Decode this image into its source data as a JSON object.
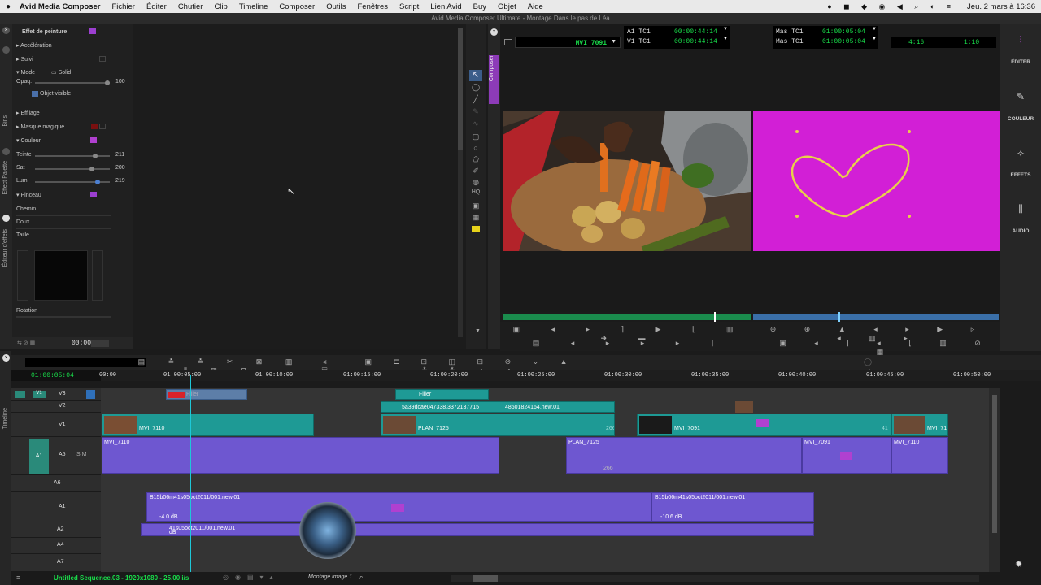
{
  "menubar": {
    "apple": "",
    "app": "Avid Media Composer",
    "items": [
      "Fichier",
      "Éditer",
      "Chutier",
      "Clip",
      "Timeline",
      "Composer",
      "Outils",
      "Fenêtres",
      "Script",
      "Lien Avid",
      "Buy",
      "Objet",
      "Aide"
    ],
    "datetime": "Jeu. 2 mars à 16:36"
  },
  "window_title": "Avid Media Composer Ultimate - Montage Dans le pas de Léa",
  "sidetabs": {
    "bins": "Bins",
    "effect_palette": "Effect Palette",
    "effect_editor": "Éditeur d'effets",
    "composer": "Composer",
    "timeline": "Timeline"
  },
  "effect_editor": {
    "title": "Effet de peinture",
    "acceleration": "Accélération",
    "suivi": "Suivi",
    "mode": "Mode",
    "mode_value": "Solid",
    "opacity": "Opaq.",
    "opacity_value": "100",
    "opacity_level": 1.0,
    "objet_visible": "Objet visible",
    "effilage": "Effilage",
    "masque": "Masque magique",
    "couleur": "Couleur",
    "teinte": "Teinte",
    "teinte_value": "211",
    "teinte_level": 0.83,
    "sat": "Sat",
    "sat_value": "200",
    "sat_level": 0.78,
    "lum": "Lum",
    "lum_value": "219",
    "lum_level": 0.86,
    "pinceau": "Pinceau",
    "chemin": "Chemin",
    "doux": "Doux",
    "taille": "Taille",
    "rotation": "Rotation",
    "time": "00:00"
  },
  "composer": {
    "src_clip": "MVI_7091",
    "a1_tc1": "A1  TC1",
    "a1_tc1_value": "00:00:44:14",
    "v1_tc1": "V1  TC1",
    "v1_tc1_value": "00:00:44:14",
    "mas_tc1_a": "Mas  TC1",
    "mas_tc1_a_value": "01:00:05:04",
    "mas_tc1_b": "Mas  TC1",
    "mas_tc1_b_value": "01:00:05:04",
    "dur1": "4:16",
    "dur2": "1:10"
  },
  "right_panel": {
    "editer": "ÉDITER",
    "couleur": "COULEUR",
    "effets": "EFFETS",
    "audio": "AUDIO"
  },
  "timeline": {
    "timecode": "01:00:05:04",
    "ruler": [
      "00:00",
      "01:00:05:00",
      "01:00:10:00",
      "01:00:15:00",
      "01:00:20:00",
      "01:00:25:00",
      "01:00:30:00",
      "01:00:35:00",
      "01:00:40:00",
      "01:00:45:00",
      "01:00:50:00"
    ],
    "tracks": {
      "v3": "V3",
      "v2": "V2",
      "v1": "V1",
      "a5": "A5",
      "a6": "A6",
      "a1": "A1",
      "a2": "A2",
      "a4": "A4",
      "a7": "A7",
      "v1_src": "V1",
      "a1_src": "A1"
    },
    "clips": {
      "v3_a": "Filler",
      "v3_b": "Filler",
      "v2_a": "5a39dcae047338.3372137715",
      "v2_b": "48601824164.new.01",
      "v1_a": "MVI_7110",
      "v1_b": "PLAN_7125",
      "v1_b_num": "266",
      "v1_c": "MVI_7091",
      "v1_c_num": "41",
      "v1_d": "MVI_71",
      "a5_a": "MVI_7110",
      "a5_b": "PLAN_7125",
      "a5_b_num": "266",
      "a5_c": "MVI_7091",
      "a5_d": "MVI_7110",
      "a1_a": "B15b06m41s05oct2011/001.new.01",
      "a1_a_db": "-4.0 dB",
      "a1_b": "B15b06m41s05oct2011/001.new.01",
      "a1_b_db": "-10.6 dB",
      "a2_a": "41s05oct2011/001.new.01",
      "a2_a_db": "dB"
    },
    "sequence": "Untitled Sequence.03 - 1920x1080 - 25.00 i/s",
    "bin_name": "Montage image.1"
  },
  "colors": {
    "accent_purple": "#b040d0",
    "track_teal": "#1e9a95",
    "audio_purple": "#6e57d0",
    "timecode_green": "#19e04b",
    "magenta_frame": "#d21fd6"
  }
}
